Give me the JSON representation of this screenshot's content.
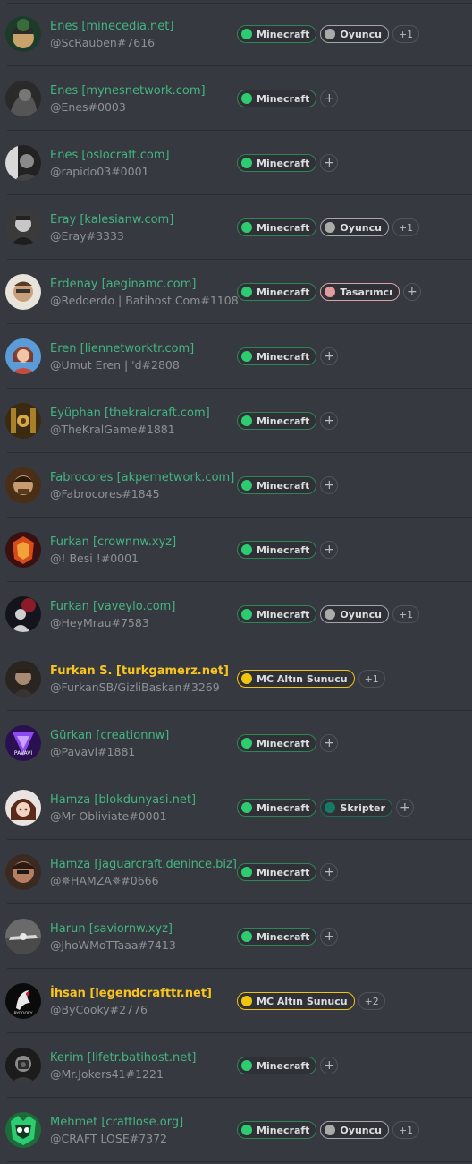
{
  "members": [
    {
      "name": "Enes [minecedia.net]",
      "tag": "@ScRauben#7616",
      "gold": false,
      "avatar": "a1",
      "roles": [
        "Minecraft",
        "Oyuncu"
      ],
      "more": "+1"
    },
    {
      "name": "Enes [mynesnetwork.com]",
      "tag": "@Enes#0003",
      "gold": false,
      "avatar": "a2",
      "roles": [
        "Minecraft"
      ],
      "more": "+"
    },
    {
      "name": "Enes [oslocraft.com]",
      "tag": "@rapido03#0001",
      "gold": false,
      "avatar": "a3",
      "roles": [
        "Minecraft"
      ],
      "more": "+"
    },
    {
      "name": "Eray [kalesianw.com]",
      "tag": "@Eray#3333",
      "gold": false,
      "avatar": "a4",
      "roles": [
        "Minecraft",
        "Oyuncu"
      ],
      "more": "+1"
    },
    {
      "name": "Erdenay [aeginamc.com]",
      "tag": "@Redoerdo | Batihost.Com#1108",
      "gold": false,
      "avatar": "a5",
      "roles": [
        "Minecraft",
        "Tasarımcı"
      ],
      "more": "+"
    },
    {
      "name": "Eren [liennetworktr.com]",
      "tag": "@Umut Eren | 'd#2808",
      "gold": false,
      "avatar": "a6",
      "roles": [
        "Minecraft"
      ],
      "more": "+"
    },
    {
      "name": "Eyüphan [thekralcraft.com]",
      "tag": "@TheKralGame#1881",
      "gold": false,
      "avatar": "a7",
      "roles": [
        "Minecraft"
      ],
      "more": "+"
    },
    {
      "name": "Fabrocores [akpernetwork.com]",
      "tag": "@Fabrocores#1845",
      "gold": false,
      "avatar": "a8",
      "roles": [
        "Minecraft"
      ],
      "more": "+"
    },
    {
      "name": "Furkan [crownnw.xyz]",
      "tag": "@! Besi !#0001",
      "gold": false,
      "avatar": "a9",
      "roles": [
        "Minecraft"
      ],
      "more": "+"
    },
    {
      "name": "Furkan [vaveylo.com]",
      "tag": "@HeyMrau#7583",
      "gold": false,
      "avatar": "a10",
      "roles": [
        "Minecraft",
        "Oyuncu"
      ],
      "more": "+1"
    },
    {
      "name": "Furkan S. [turkgamerz.net]",
      "tag": "@FurkanSB/GizliBaskan#3269",
      "gold": true,
      "avatar": "a11",
      "roles": [
        "MC Altın Sunucu"
      ],
      "more": "+1"
    },
    {
      "name": "Gürkan [creationnw]",
      "tag": "@Pavavi#1881",
      "gold": false,
      "avatar": "a12",
      "roles": [
        "Minecraft"
      ],
      "more": "+"
    },
    {
      "name": "Hamza [blokdunyasi.net]",
      "tag": "@Mr Obliviate#0001",
      "gold": false,
      "avatar": "a13",
      "roles": [
        "Minecraft",
        "Skripter"
      ],
      "more": "+"
    },
    {
      "name": "Hamza [jaguarcraft.denince.biz]",
      "tag": "@✵HAMZA✵#0666",
      "gold": false,
      "avatar": "a14",
      "roles": [
        "Minecraft"
      ],
      "more": "+"
    },
    {
      "name": "Harun [saviornw.xyz]",
      "tag": "@JhoWMoTTaaa#7413",
      "gold": false,
      "avatar": "a15",
      "roles": [
        "Minecraft"
      ],
      "more": "+"
    },
    {
      "name": "İhsan [legendcrafttr.net]",
      "tag": "@ByCooky#2776",
      "gold": true,
      "avatar": "a16",
      "roles": [
        "MC Altın Sunucu"
      ],
      "more": "+2"
    },
    {
      "name": "Kerim [lifetr.batihost.net]",
      "tag": "@Mr.Jokers41#1221",
      "gold": false,
      "avatar": "a17",
      "roles": [
        "Minecraft"
      ],
      "more": "+"
    },
    {
      "name": "Mehmet [craftlose.org]",
      "tag": "@CRAFT LOSE#7372",
      "gold": false,
      "avatar": "a18",
      "roles": [
        "Minecraft",
        "Oyuncu"
      ],
      "more": "+1"
    }
  ],
  "colors": {
    "background": "#36393f",
    "member_green": "#43b581",
    "member_gold": "#f9c41f",
    "minecraft_role": "#2ecc71",
    "oyuncu_role": "#aaaaaa",
    "tasarimci_role": "#e39b9f",
    "skripter_role": "#177a64",
    "altin_role": "#f1c40f"
  },
  "icons": {
    "add_role": "plus-icon"
  }
}
